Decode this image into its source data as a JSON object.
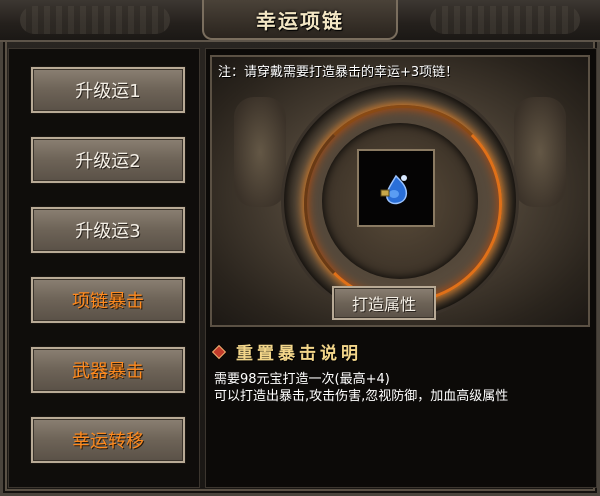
{
  "window": {
    "title": "幸运项链"
  },
  "sidebar": {
    "buttons": [
      {
        "label": "升级运1",
        "color": "#f4efe6"
      },
      {
        "label": "升级运2",
        "color": "#f4efe6"
      },
      {
        "label": "升级运3",
        "color": "#f4efe6"
      },
      {
        "label": "项链暴击",
        "color": "#ff8a1e"
      },
      {
        "label": "武器暴击",
        "color": "#ff8a1e"
      },
      {
        "label": "幸运转移",
        "color": "#ff8a1e"
      }
    ]
  },
  "main": {
    "notice": "注：请穿戴需要打造暴击的幸运+3项链！",
    "slot_item_icon": "blue-potion-icon",
    "forge_button_label": "打造属性",
    "section_title": "重置暴击说明",
    "description_lines": [
      "需要98元宝打造一次(最高+4)",
      "可以打造出暴击,攻击伤害,忽视防御，加血高级属性"
    ]
  },
  "colors": {
    "accent_orange": "#ff8a1e",
    "title_gold": "#f3d68a",
    "ring_glow": "#e07018"
  }
}
